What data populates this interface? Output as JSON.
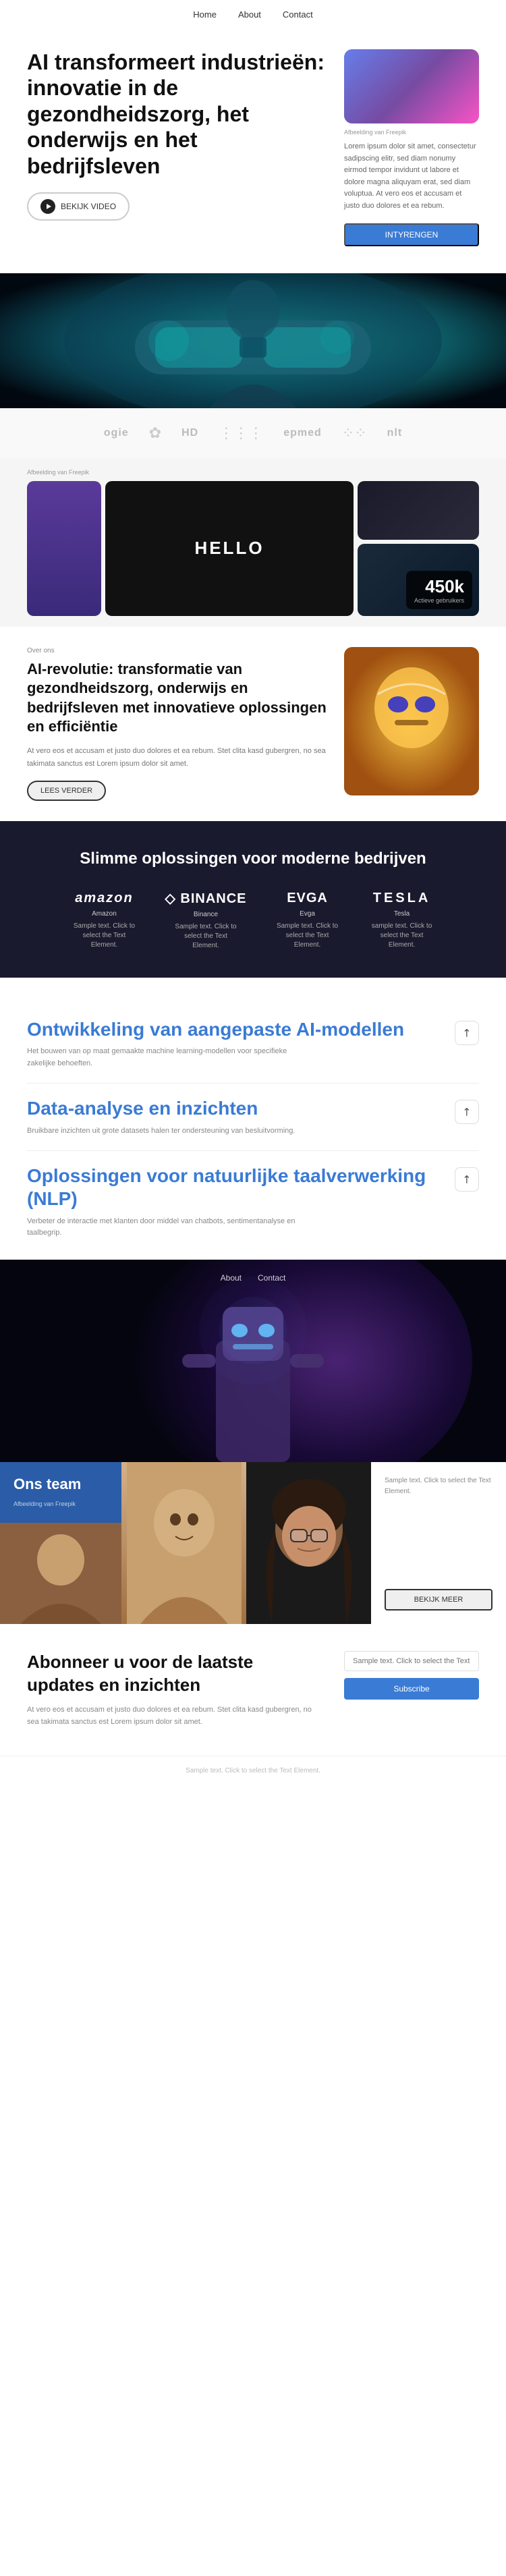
{
  "nav": {
    "links": [
      "Home",
      "About",
      "Contact"
    ]
  },
  "hero": {
    "title": "AI transformeert industrieën: innovatie in de gezondheidszorg, het onderwijs en het bedrijfsleven",
    "watch_btn": "BEKIJK VIDEO",
    "caption": "Afbeelding van Freepik",
    "body_text": "Lorem ipsum dolor sit amet, consectetur sadipscing elitr, sed diam nonumy eirmod tempor invidunt ut labore et dolore magna aliquyam erat, sed diam voluptua. At vero eos et accusam et justo duo dolores et ea rebum.",
    "subscribe_btn": "INTYRENGEN"
  },
  "logos": [
    {
      "text": "ogie",
      "type": "text"
    },
    {
      "text": "✿",
      "type": "symbol"
    },
    {
      "text": "HD",
      "type": "text"
    },
    {
      "text": "⋮⋮⋮",
      "type": "symbol"
    },
    {
      "text": "epmed",
      "type": "text"
    },
    {
      "text": "⁘⁘",
      "type": "symbol"
    },
    {
      "text": "nlt",
      "type": "text"
    }
  ],
  "gallery": {
    "caption": "Afbeelding van Freepik",
    "hello": "HELLO",
    "counter": {
      "number": "450k",
      "label": "Actieve gebruikers"
    }
  },
  "about": {
    "label": "Over ons",
    "title": "AI-revolutie: transformatie van gezondheidszorg, onderwijs en bedrijfsleven met innovatieve oplossingen en efficiëntie",
    "body": "At vero eos et accusam et justo duo dolores et ea rebum. Stet clita kasd gubergren, no sea takimata sanctus est Lorem ipsum dolor sit amet.",
    "read_more": "LEES VERDER"
  },
  "dark_section": {
    "title": "Slimme oplossingen voor moderne bedrijven",
    "brands": [
      {
        "name": "amazon",
        "label": "Amazon",
        "desc": "Sample text. Click to select the Text Element."
      },
      {
        "name": "◇ BINANCE",
        "label": "Binance",
        "desc": "Sample text. Click to select the Text Element."
      },
      {
        "name": "EVGA",
        "label": "Evga",
        "desc": "Sample text. Click to select the Text Element."
      },
      {
        "name": "TESLA",
        "label": "Tesla",
        "desc": "sample text. Click to select the Text Element."
      }
    ]
  },
  "services": [
    {
      "title": "Ontwikkeling van aangepaste AI-modellen",
      "desc": "Het bouwen van op maat gemaakte machine learning-modellen voor specifieke zakelijke behoeften."
    },
    {
      "title": "Data-analyse en inzichten",
      "desc": "Bruikbare inzichten uit grote datasets halen ter ondersteuning van besluitvorming."
    },
    {
      "title": "Oplossingen voor natuurlijke taalverwerking (NLP)",
      "desc": "Verbeter de interactie met klanten door middel van chatbots, sentimentanalyse en taalbegrip."
    }
  ],
  "nav_overlay": [
    "About",
    "Contact"
  ],
  "team": {
    "title": "Ons team",
    "caption": "Afbeelding van Freepik",
    "side_text": "Sample text. Click to select the Text Element.",
    "explore_btn": "BEKIJK MEER"
  },
  "subscribe": {
    "title": "Abonneer u voor de laatste updates en inzichten",
    "body": "At vero eos et accusam et justo duo dolores et ea rebum. Stet clita kasd gubergren, no sea takimata sanctus est Lorem ipsum dolor sit amet.",
    "input_placeholder": "Sample text. Click to select the Text Element.",
    "btn": "Subscribe",
    "footer_text": "Sample text. Click to select the Text Element."
  }
}
